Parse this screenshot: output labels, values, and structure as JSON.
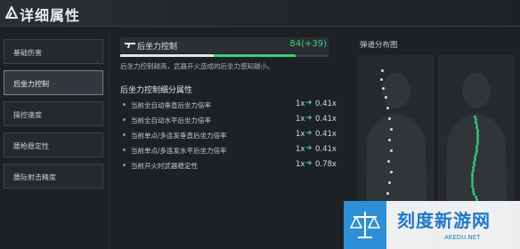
{
  "header": {
    "title": "详细属性"
  },
  "tabs": [
    {
      "label": "基础伤害",
      "active": false
    },
    {
      "label": "后坐力控制",
      "active": true
    },
    {
      "label": "操控速度",
      "active": false
    },
    {
      "label": "腰枪稳定性",
      "active": false
    },
    {
      "label": "腰际射击精度",
      "active": false
    }
  ],
  "stat": {
    "name": "后坐力控制",
    "value": "84(+39)",
    "base_fraction": 0.45,
    "bonus_fraction": 0.39,
    "description": "后坐力控制越高，武器开火造成的后坐力感知越小。",
    "icon": "rifle-icon"
  },
  "breakdown": {
    "title": "后坐力控制细分属性",
    "rows": [
      {
        "label": "当前全自动垂直后坐力倍率",
        "from": "1x",
        "to": "0.41x"
      },
      {
        "label": "当前全自动水平后坐力倍率",
        "from": "1x",
        "to": "0.41x"
      },
      {
        "label": "当前单点/多连发垂直后坐力倍率",
        "from": "1x",
        "to": "0.41x"
      },
      {
        "label": "当前单点/多连发水平后坐力倍率",
        "from": "1x",
        "to": "0.41x"
      },
      {
        "label": "当前开火时武器稳定性",
        "from": "1x",
        "to": "0.78x"
      }
    ]
  },
  "spread": {
    "title": "弹道分布图"
  },
  "colors": {
    "accent_green": "#3ad07a",
    "bg": "#1d2125",
    "panel": "#2a2f34"
  },
  "watermark": {
    "text": "刻度新游网",
    "url": "AKEDU.NET"
  }
}
